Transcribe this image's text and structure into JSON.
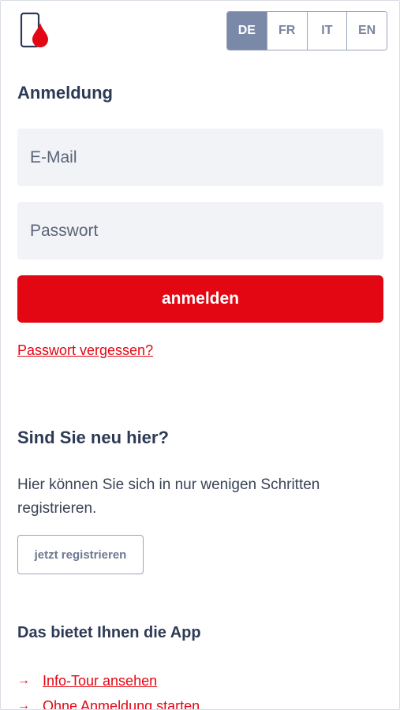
{
  "header": {
    "logo_icon": "phone-blood-drop-icon",
    "languages": [
      {
        "label": "DE",
        "active": true
      },
      {
        "label": "FR",
        "active": false
      },
      {
        "label": "IT",
        "active": false
      },
      {
        "label": "EN",
        "active": false
      }
    ]
  },
  "login": {
    "title": "Anmeldung",
    "email_placeholder": "E-Mail",
    "password_placeholder": "Passwort",
    "submit_label": "anmelden",
    "forgot_label": "Passwort vergessen?"
  },
  "register": {
    "title": "Sind Sie neu hier?",
    "text": "Hier können Sie sich in nur wenigen Schritten registrieren.",
    "button_label": "jetzt registrieren"
  },
  "app_info": {
    "title": "Das bietet Ihnen die App",
    "links": [
      {
        "icon": "arrow-right-icon",
        "label": "Info-Tour ansehen"
      },
      {
        "icon": "arrow-right-icon",
        "label": "Ohne Anmeldung starten"
      }
    ]
  },
  "colors": {
    "brand_red": "#e30613",
    "navy": "#2d3a55",
    "active_lang_bg": "#7a89a8",
    "field_bg": "#f1f3f6"
  }
}
